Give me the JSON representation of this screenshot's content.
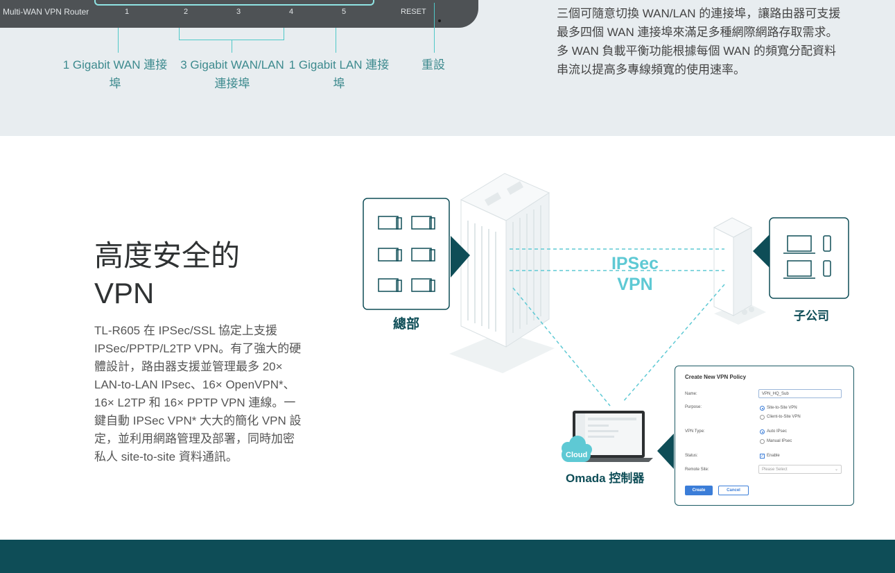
{
  "router": {
    "title": "Multi-WAN VPN Router",
    "ports": [
      "1",
      "2",
      "3",
      "4",
      "5"
    ],
    "reset": "RESET"
  },
  "port_captions": [
    "1 Gigabit WAN 連接埠",
    "3 Gigabit WAN/LAN 連接埠",
    "1 Gigabit LAN 連接埠",
    "重設"
  ],
  "feature_text": "三個可隨意切換 WAN/LAN 的連接埠，讓路由器可支援最多四個 WAN 連接埠來滿足多種網際網路存取需求。多 WAN 負載平衡功能根據每個 WAN 的頻寬分配資料串流以提高多專線頻寬的使用速率。",
  "vpn": {
    "title_line1": "高度安全的",
    "title_line2": "VPN",
    "description": "TL-R605 在 IPSec/SSL 協定上支援 IPSec/PPTP/L2TP VPN。有了強大的硬體設計，路由器支援並管理最多 20× LAN-to-LAN IPsec、16× OpenVPN*、16× L2TP 和 16× PPTP VPN 連線。一鍵自動 IPSec VPN* 大大的簡化 VPN 設定，並利用網路管理及部署，同時加密私人 site-to-site 資料通訊。"
  },
  "diagram": {
    "hq_label": "總部",
    "branch_label": "子公司",
    "ipsec_line1": "IPSec",
    "ipsec_line2": "VPN",
    "cloud_label": "Cloud",
    "controller_label": "Omada 控制器"
  },
  "policy_form": {
    "title": "Create New VPN Policy",
    "name_label": "Name:",
    "name_value": "VPN_HQ_Sub",
    "purpose_label": "Purpose:",
    "purpose_options": [
      "Site-to-Site VPN",
      "Client-to-Site VPN"
    ],
    "vpn_type_label": "VPN Type:",
    "vpn_type_options": [
      "Auto IPsec",
      "Manual IPsec"
    ],
    "status_label": "Status:",
    "status_value": "Enable",
    "remote_site_label": "Remote Site:",
    "remote_site_placeholder": "Please Select",
    "create_button": "Create",
    "cancel_button": "Cancel"
  },
  "colors": {
    "accent_teal": "#0e4d57",
    "light_teal": "#5ec9d4",
    "band_gray": "#e8edf0",
    "button_blue": "#3b7dd8"
  }
}
